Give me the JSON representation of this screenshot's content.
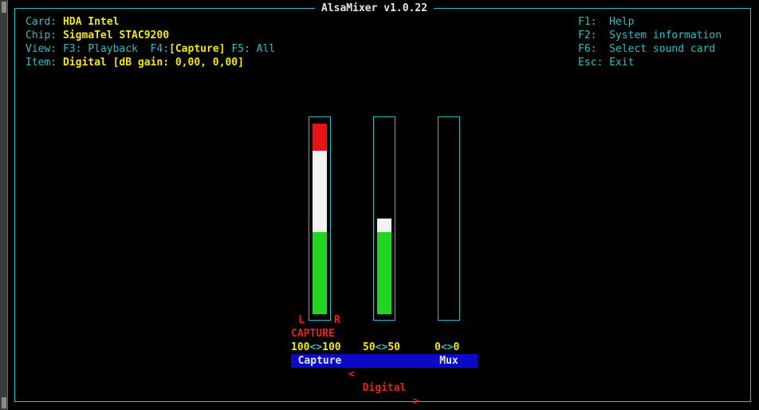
{
  "title": "AlsaMixer v1.0.22",
  "info": {
    "card_label": "Card:",
    "card_value": "HDA Intel",
    "chip_label": "Chip:",
    "chip_value": "SigmaTel STAC9200",
    "view_label": "View:",
    "view_f3": "F3: Playback",
    "view_f4_key": "F4:",
    "view_f4_active": "[Capture]",
    "view_f5": "F5: All",
    "item_label": "Item:",
    "item_value": "Digital [dB gain: 0,00, 0,00]"
  },
  "help": [
    {
      "key": "F1:",
      "text": "Help"
    },
    {
      "key": "F2:",
      "text": "System information"
    },
    {
      "key": "F6:",
      "text": "Select sound card"
    },
    {
      "key": "Esc:",
      "text": "Exit"
    }
  ],
  "controls": [
    {
      "name": "Capture",
      "value_left": "100",
      "sep": "<>",
      "value_right": "100",
      "channel_left": "L",
      "channel_right": "R",
      "capture_label": "CAPTURE",
      "level_percent": 100,
      "selected": false
    },
    {
      "name": "Digital",
      "value_left": "50",
      "sep": "<>",
      "value_right": "50",
      "level_percent": 50,
      "selected": true,
      "sel_left": "<",
      "sel_right": ">"
    },
    {
      "name": "Mux",
      "value_left": "0",
      "sep": "<>",
      "value_right": "0",
      "level_percent": 0,
      "selected": false
    }
  ],
  "colors": {
    "border": "#29c2c8",
    "label": "#29c2c8",
    "value": "#f2e60f",
    "level_low": "#23d423",
    "level_mid": "#f2f2f2",
    "level_high": "#e31515",
    "name_background": "#0a0ac8",
    "selected_name": "#ea1f1f"
  }
}
